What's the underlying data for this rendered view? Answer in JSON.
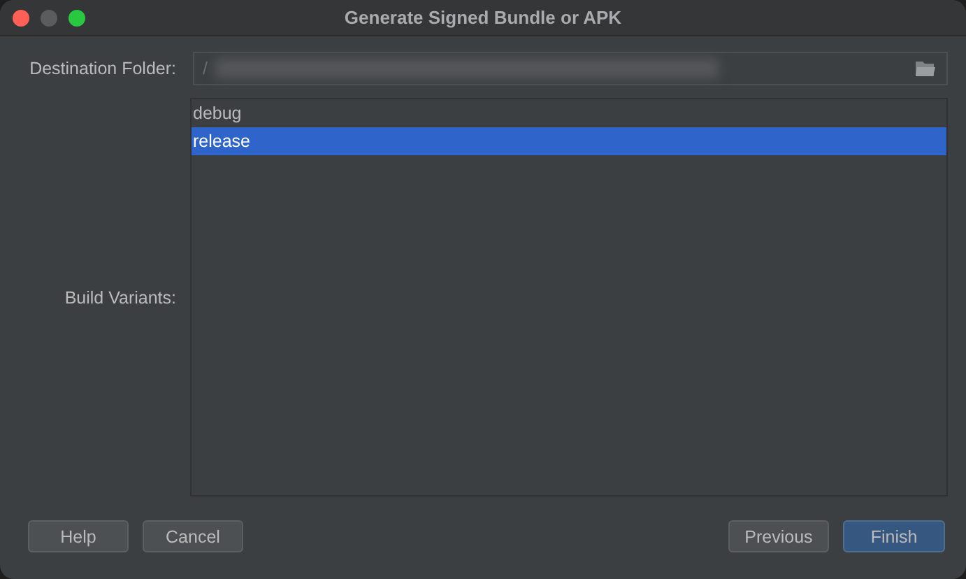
{
  "window": {
    "title": "Generate Signed Bundle or APK"
  },
  "destination": {
    "label": "Destination Folder:",
    "value": "/"
  },
  "build_variants": {
    "label": "Build Variants:",
    "items": [
      {
        "label": "debug",
        "selected": false
      },
      {
        "label": "release",
        "selected": true
      }
    ]
  },
  "buttons": [
    {
      "label": "Help",
      "kind": "secondary"
    },
    {
      "label": "Cancel",
      "kind": "secondary"
    },
    {
      "label": "Previous",
      "kind": "secondary"
    },
    {
      "label": "Finish",
      "kind": "primary"
    }
  ]
}
